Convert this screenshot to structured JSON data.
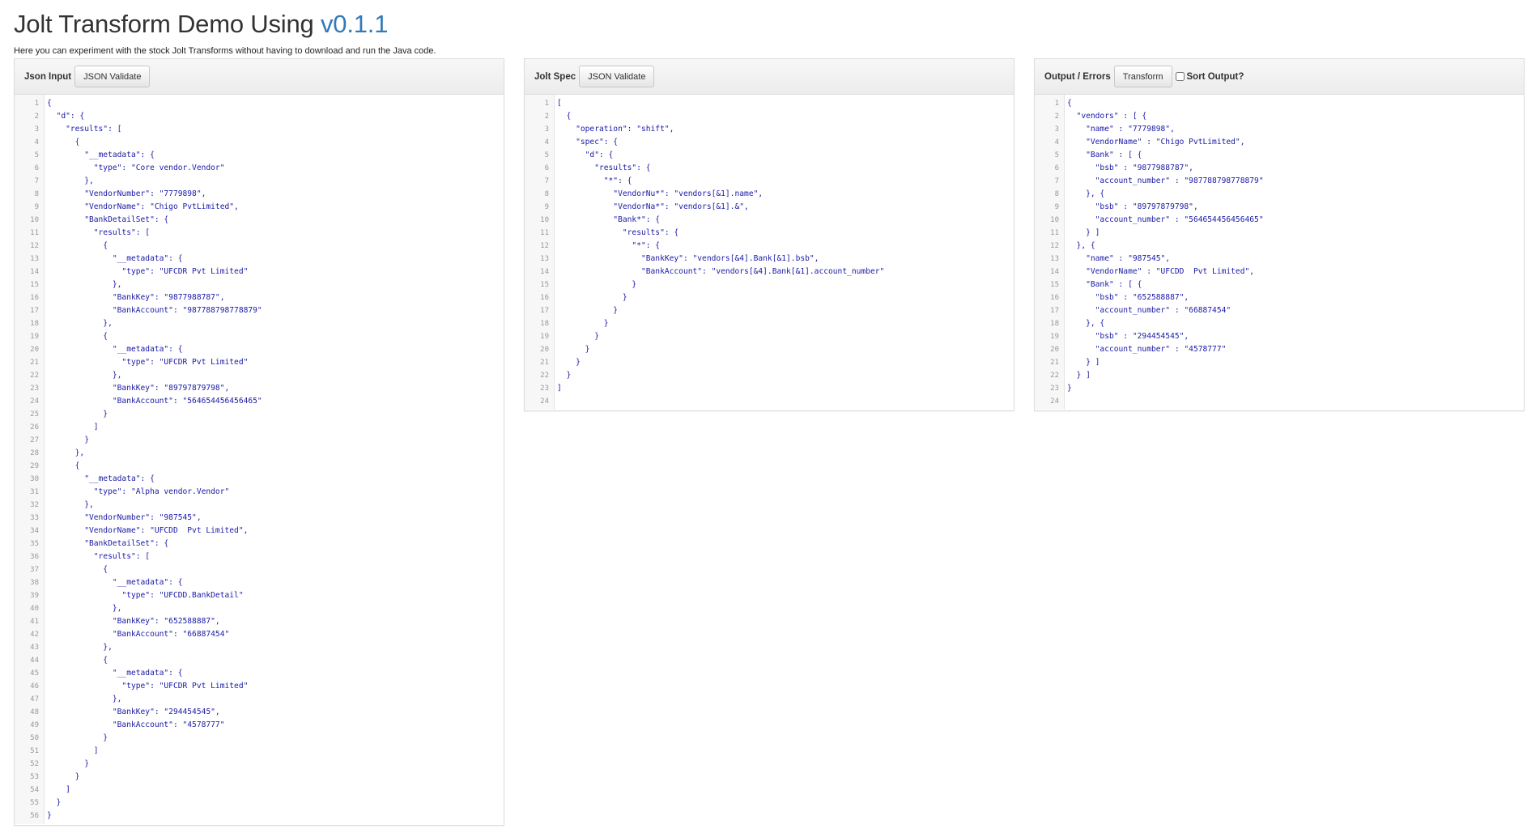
{
  "header": {
    "title": "Jolt Transform Demo Using",
    "version": "v0.1.1",
    "subtitle": "Here you can experiment with the stock Jolt Transforms without having to download and run the Java code."
  },
  "panels": {
    "input": {
      "label": "Json Input",
      "button": "JSON Validate",
      "lines": [
        "{",
        "  \"d\": {",
        "    \"results\": [",
        "      {",
        "        \"__metadata\": {",
        "          \"type\": \"Core vendor.Vendor\"",
        "        },",
        "        \"VendorNumber\": \"7779898\",",
        "        \"VendorName\": \"Chigo PvtLimited\",",
        "        \"BankDetailSet\": {",
        "          \"results\": [",
        "            {",
        "              \"__metadata\": {",
        "                \"type\": \"UFCDR Pvt Limited\"",
        "              },",
        "              \"BankKey\": \"9877988787\",",
        "              \"BankAccount\": \"987788798778879\"",
        "            },",
        "            {",
        "              \"__metadata\": {",
        "                \"type\": \"UFCDR Pvt Limited\"",
        "              },",
        "              \"BankKey\": \"89797879798\",",
        "              \"BankAccount\": \"564654456456465\"",
        "            }",
        "          ]",
        "        }",
        "      },",
        "      {",
        "        \"__metadata\": {",
        "          \"type\": \"Alpha vendor.Vendor\"",
        "        },",
        "        \"VendorNumber\": \"987545\",",
        "        \"VendorName\": \"UFCDD  Pvt Limited\",",
        "        \"BankDetailSet\": {",
        "          \"results\": [",
        "            {",
        "              \"__metadata\": {",
        "                \"type\": \"UFCDD.BankDetail\"",
        "              },",
        "              \"BankKey\": \"652588887\",",
        "              \"BankAccount\": \"66887454\"",
        "            },",
        "            {",
        "              \"__metadata\": {",
        "                \"type\": \"UFCDR Pvt Limited\"",
        "              },",
        "              \"BankKey\": \"294454545\",",
        "              \"BankAccount\": \"4578777\"",
        "            }",
        "          ]",
        "        }",
        "      }",
        "    ]",
        "  }",
        "}"
      ]
    },
    "spec": {
      "label": "Jolt Spec",
      "button": "JSON Validate",
      "lines": [
        "[",
        "  {",
        "    \"operation\": \"shift\",",
        "    \"spec\": {",
        "      \"d\": {",
        "        \"results\": {",
        "          \"*\": {",
        "            \"VendorNu*\": \"vendors[&1].name\",",
        "            \"VendorNa*\": \"vendors[&1].&\",",
        "            \"Bank*\": {",
        "              \"results\": {",
        "                \"*\": {",
        "                  \"BankKey\": \"vendors[&4].Bank[&1].bsb\",",
        "                  \"BankAccount\": \"vendors[&4].Bank[&1].account_number\"",
        "                }",
        "              }",
        "            }",
        "          }",
        "        }",
        "      }",
        "    }",
        "  }",
        "]",
        ""
      ]
    },
    "output": {
      "label": "Output / Errors",
      "button": "Transform",
      "sort_label": "Sort Output?",
      "lines": [
        "{",
        "  \"vendors\" : [ {",
        "    \"name\" : \"7779898\",",
        "    \"VendorName\" : \"Chigo PvtLimited\",",
        "    \"Bank\" : [ {",
        "      \"bsb\" : \"9877988787\",",
        "      \"account_number\" : \"987788798778879\"",
        "    }, {",
        "      \"bsb\" : \"89797879798\",",
        "      \"account_number\" : \"564654456456465\"",
        "    } ]",
        "  }, {",
        "    \"name\" : \"987545\",",
        "    \"VendorName\" : \"UFCDD  Pvt Limited\",",
        "    \"Bank\" : [ {",
        "      \"bsb\" : \"652588887\",",
        "      \"account_number\" : \"66887454\"",
        "    }, {",
        "      \"bsb\" : \"294454545\",",
        "      \"account_number\" : \"4578777\"",
        "    } ]",
        "  } ]",
        "}",
        ""
      ]
    }
  }
}
